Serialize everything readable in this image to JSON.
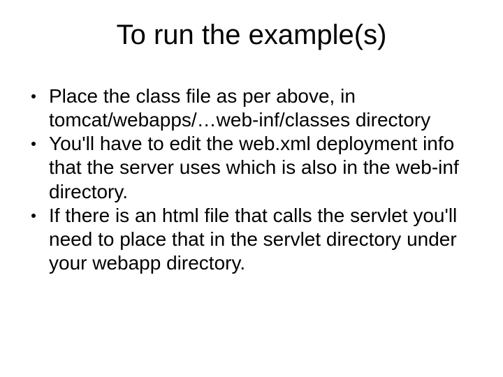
{
  "slide": {
    "title": "To run the example(s)",
    "bullets": [
      "Place the class file as per above, in tomcat/webapps/…web-inf/classes directory",
      "You'll have to edit the web.xml deployment info that the server uses which is also in the web-inf directory.",
      "If there is an html file that calls the servlet you'll need to place that in the servlet directory under your webapp directory."
    ]
  }
}
